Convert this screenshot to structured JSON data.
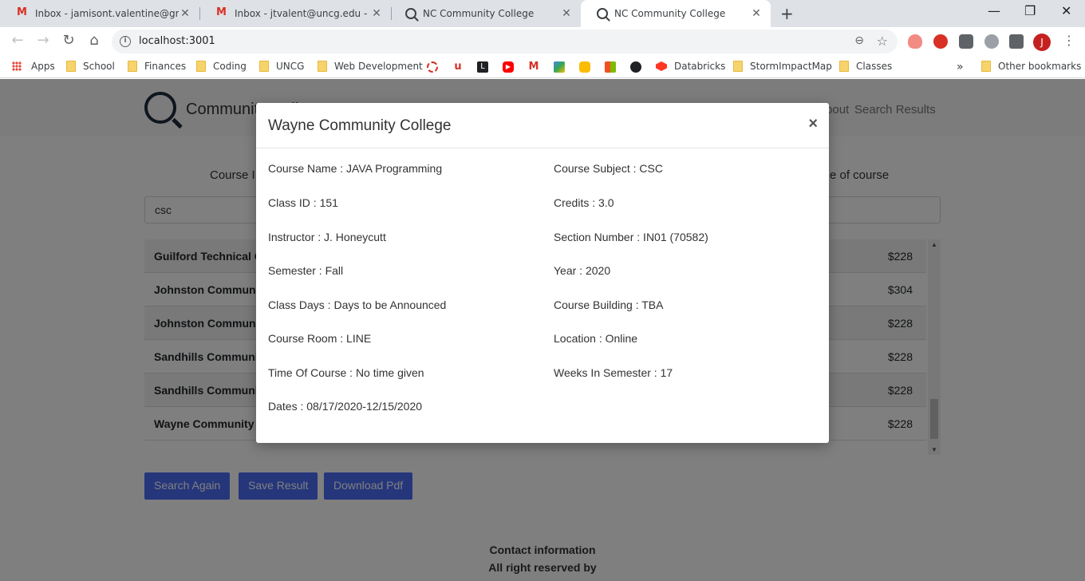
{
  "browser": {
    "tabs": [
      {
        "title": "Inbox - jamisont.valentine@gmail.com",
        "icon": "gmail-icon",
        "active": false
      },
      {
        "title": "Inbox - jtvalent@uncg.edu - UNCG",
        "icon": "gmail-icon",
        "active": false
      },
      {
        "title": "NC Community College",
        "icon": "search-icon",
        "active": false
      },
      {
        "title": "NC Community College",
        "icon": "search-icon",
        "active": true
      }
    ],
    "new_tab": "+",
    "url": "localhost:3001",
    "profile_initial": "J",
    "bookmarks": [
      {
        "label": "Apps",
        "icon": "apps-icon"
      },
      {
        "label": "School",
        "icon": "folder-icon"
      },
      {
        "label": "Finances",
        "icon": "folder-icon"
      },
      {
        "label": "Coding",
        "icon": "folder-icon"
      },
      {
        "label": "UNCG",
        "icon": "folder-icon"
      },
      {
        "label": "Web Development",
        "icon": "folder-icon"
      },
      {
        "label": "Databricks",
        "icon": "databricks-icon"
      },
      {
        "label": "StormImpactMap",
        "icon": "folder-icon"
      },
      {
        "label": "Classes",
        "icon": "folder-icon"
      }
    ],
    "overflow": "»",
    "other_bookmarks": "Other bookmarks"
  },
  "site": {
    "brand": "Community College",
    "nav": [
      "About",
      "Search Results"
    ],
    "hint_left": "Course ID",
    "hint_right": "e of course",
    "search_value": "csc",
    "results": [
      {
        "college": "Guilford Technical Community College",
        "cost": "$228"
      },
      {
        "college": "Johnston Community College",
        "cost": "$304"
      },
      {
        "college": "Johnston Community College",
        "cost": "$228"
      },
      {
        "college": "Sandhills Community College",
        "cost": "$228"
      },
      {
        "college": "Sandhills Community College",
        "cost": "$228"
      },
      {
        "college": "Wayne Community College",
        "cost": "$228"
      }
    ],
    "buttons": {
      "search_again": "Search Again",
      "save_result": "Save Result",
      "download_pdf": "Download Pdf"
    },
    "footer": {
      "line1": "Contact information",
      "line2": "All right reserved by"
    }
  },
  "modal": {
    "title": "Wayne Community College",
    "close": "×",
    "fields_left": [
      "Course Name : JAVA Programming",
      "Class ID : 151",
      "Instructor : J. Honeycutt",
      "Semester : Fall",
      "Class Days : Days to be Announced",
      "Course Room : LINE",
      "Time Of Course : No time given",
      "Dates : 08/17/2020-12/15/2020"
    ],
    "fields_right": [
      "Course Subject : CSC",
      "Credits : 3.0",
      "Section Number : IN01 (70582)",
      "Year : 2020",
      "Course Building : TBA",
      "Location : Online",
      "Weeks In Semester : 17"
    ]
  }
}
